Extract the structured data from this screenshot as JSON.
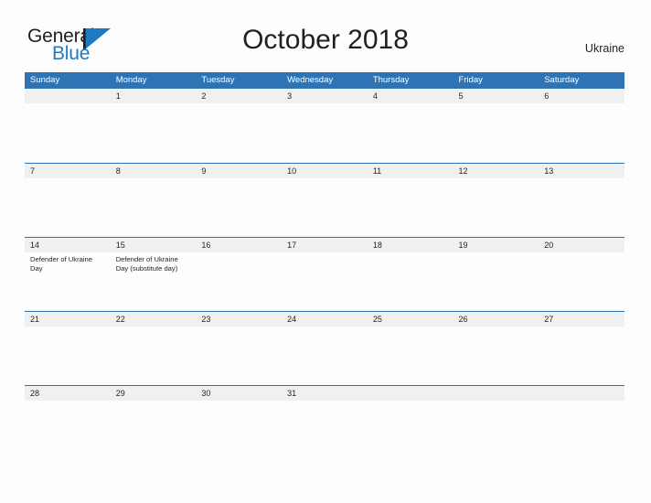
{
  "brand": {
    "name_part1": "General",
    "name_part2": "Blue",
    "sail_icon": "sail-triangle-icon",
    "blue": "#1f7ac1"
  },
  "header": {
    "title": "October 2018",
    "country": "Ukraine"
  },
  "theme": {
    "header_blue": "#2e74b5",
    "band_gray": "#f0f0f0",
    "text": "#231f20",
    "page_background": "#fdfdfd"
  },
  "calendar": {
    "month": "October",
    "year": "2018",
    "weekday_headers": [
      "Sunday",
      "Monday",
      "Tuesday",
      "Wednesday",
      "Thursday",
      "Friday",
      "Saturday"
    ],
    "weeks": [
      [
        {
          "day": "",
          "events": []
        },
        {
          "day": "1",
          "events": []
        },
        {
          "day": "2",
          "events": []
        },
        {
          "day": "3",
          "events": []
        },
        {
          "day": "4",
          "events": []
        },
        {
          "day": "5",
          "events": []
        },
        {
          "day": "6",
          "events": []
        }
      ],
      [
        {
          "day": "7",
          "events": []
        },
        {
          "day": "8",
          "events": []
        },
        {
          "day": "9",
          "events": []
        },
        {
          "day": "10",
          "events": []
        },
        {
          "day": "11",
          "events": []
        },
        {
          "day": "12",
          "events": []
        },
        {
          "day": "13",
          "events": []
        }
      ],
      [
        {
          "day": "14",
          "events": [
            "Defender of Ukraine Day"
          ]
        },
        {
          "day": "15",
          "events": [
            "Defender of Ukraine Day (substitute day)"
          ]
        },
        {
          "day": "16",
          "events": []
        },
        {
          "day": "17",
          "events": []
        },
        {
          "day": "18",
          "events": []
        },
        {
          "day": "19",
          "events": []
        },
        {
          "day": "20",
          "events": []
        }
      ],
      [
        {
          "day": "21",
          "events": []
        },
        {
          "day": "22",
          "events": []
        },
        {
          "day": "23",
          "events": []
        },
        {
          "day": "24",
          "events": []
        },
        {
          "day": "25",
          "events": []
        },
        {
          "day": "26",
          "events": []
        },
        {
          "day": "27",
          "events": []
        }
      ],
      [
        {
          "day": "28",
          "events": []
        },
        {
          "day": "29",
          "events": []
        },
        {
          "day": "30",
          "events": []
        },
        {
          "day": "31",
          "events": []
        },
        {
          "day": "",
          "events": []
        },
        {
          "day": "",
          "events": []
        },
        {
          "day": "",
          "events": []
        }
      ]
    ]
  }
}
